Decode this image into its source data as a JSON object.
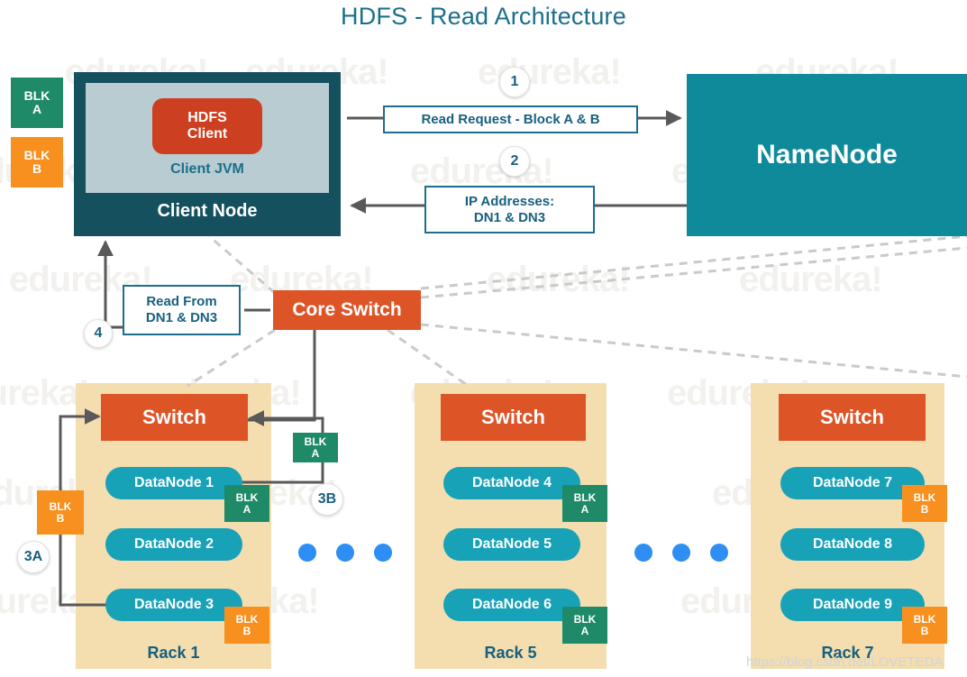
{
  "page": {
    "title": "HDFS - Read Architecture",
    "background_watermark_text": "edureka!",
    "source_watermark": "https://blog.csdn.net/LOVETEDA"
  },
  "colors": {
    "title_blue": "#1b6e8c",
    "client_node_bg": "#14505e",
    "client_jvm_bg": "#b8ccd1",
    "hdfs_client_bg": "#cc3f20",
    "namenode_bg": "#0e8a9b",
    "switch_orange": "#dd5427",
    "rack_bg": "#f4ddaf",
    "datanode_teal": "#17a2b8",
    "blk_a_green": "#1f8a68",
    "blk_b_orange": "#f7901e",
    "callout_border": "#1b6e8c",
    "dot_blue": "#2f8ef4",
    "wire_gray": "#59595b"
  },
  "client": {
    "node_label": "Client Node",
    "jvm_label": "Client JVM",
    "hdfs_client_line1": "HDFS",
    "hdfs_client_line2": "Client"
  },
  "namenode": {
    "label": "NameNode"
  },
  "pending_blocks": [
    {
      "name": "blk-a",
      "line1": "BLK",
      "line2": "A",
      "type": "a"
    },
    {
      "name": "blk-b",
      "line1": "BLK",
      "line2": "B",
      "type": "b"
    }
  ],
  "steps": [
    {
      "id": "1",
      "label": "1"
    },
    {
      "id": "2",
      "label": "2"
    },
    {
      "id": "4",
      "label": "4"
    },
    {
      "id": "3A",
      "label": "3A"
    },
    {
      "id": "3B",
      "label": "3B"
    }
  ],
  "callouts": {
    "read_request": {
      "line1": "Read Request - Block A & B"
    },
    "ip_addresses": {
      "line1": "IP Addresses:",
      "line2": "DN1 & DN3"
    },
    "read_from": {
      "line1": "Read From",
      "line2": "DN1 & DN3"
    }
  },
  "core_switch": {
    "label": "Core Switch"
  },
  "racks": [
    {
      "id": "rack1",
      "label": "Rack 1",
      "switch_label": "Switch",
      "datanodes": [
        {
          "label": "DataNode 1",
          "block": {
            "line1": "BLK",
            "line2": "A",
            "type": "a"
          }
        },
        {
          "label": "DataNode 2",
          "block": null
        },
        {
          "label": "DataNode 3",
          "block": {
            "line1": "BLK",
            "line2": "B",
            "type": "b"
          }
        }
      ]
    },
    {
      "id": "rack5",
      "label": "Rack 5",
      "switch_label": "Switch",
      "datanodes": [
        {
          "label": "DataNode 4",
          "block": {
            "line1": "BLK",
            "line2": "A",
            "type": "a"
          }
        },
        {
          "label": "DataNode 5",
          "block": null
        },
        {
          "label": "DataNode 6",
          "block": {
            "line1": "BLK",
            "line2": "A",
            "type": "a"
          }
        }
      ]
    },
    {
      "id": "rack7",
      "label": "Rack 7",
      "switch_label": "Switch",
      "datanodes": [
        {
          "label": "DataNode 7",
          "block": {
            "line1": "BLK",
            "line2": "B",
            "type": "b"
          }
        },
        {
          "label": "DataNode 8",
          "block": null
        },
        {
          "label": "DataNode 9",
          "block": {
            "line1": "BLK",
            "line2": "B",
            "type": "b"
          }
        }
      ]
    }
  ],
  "transit_blocks": [
    {
      "name": "blk-a-transit-rack1",
      "line1": "BLK",
      "line2": "A",
      "type": "a"
    },
    {
      "name": "blk-b-transit-rack1",
      "line1": "BLK",
      "line2": "B",
      "type": "b"
    }
  ],
  "ellipsis_groups": [
    {
      "name": "ellipsis-left",
      "count": 3
    },
    {
      "name": "ellipsis-right",
      "count": 3
    }
  ]
}
